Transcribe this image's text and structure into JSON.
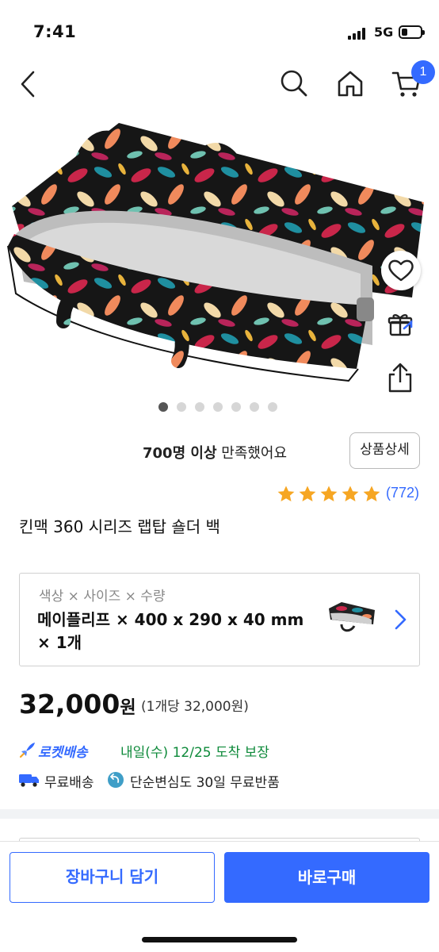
{
  "status_bar": {
    "time": "7:41",
    "network": "5G"
  },
  "nav": {
    "cart_count": "1"
  },
  "carousel": {
    "total": 7,
    "active_index": 0
  },
  "satisfaction": {
    "count": "700명 이상",
    "text": " 만족했어요"
  },
  "detail_button": "상품상세",
  "rating": {
    "stars": 5,
    "review_count": "(772)"
  },
  "product_title": "킨맥 360 시리즈 랩탑 숄더 백",
  "option": {
    "label": "색상 × 사이즈 × 수량",
    "value": "메이플리프 × 400 x 290 x 40 mm × 1개"
  },
  "price": {
    "amount": "32,000",
    "currency": "원",
    "unit_price": "(1개당 32,000원)"
  },
  "delivery": {
    "rocket_name": "로켓배송",
    "arrival": "내일(수) 12/25 도착 보장",
    "free_shipping": "무료배송",
    "free_return": "단순변심도 30일 무료반품"
  },
  "actions": {
    "add_to_cart": "장바구니 담기",
    "buy_now": "바로구매"
  },
  "colors": {
    "accent": "#346aff",
    "arrival_green": "#0e8a3a",
    "star": "#f6a623"
  },
  "icons": [
    "back-icon",
    "search-icon",
    "home-icon",
    "cart-icon",
    "heart-icon",
    "gift-icon",
    "share-icon",
    "rocket-icon",
    "truck-icon",
    "return-icon",
    "chevron-right-icon"
  ]
}
